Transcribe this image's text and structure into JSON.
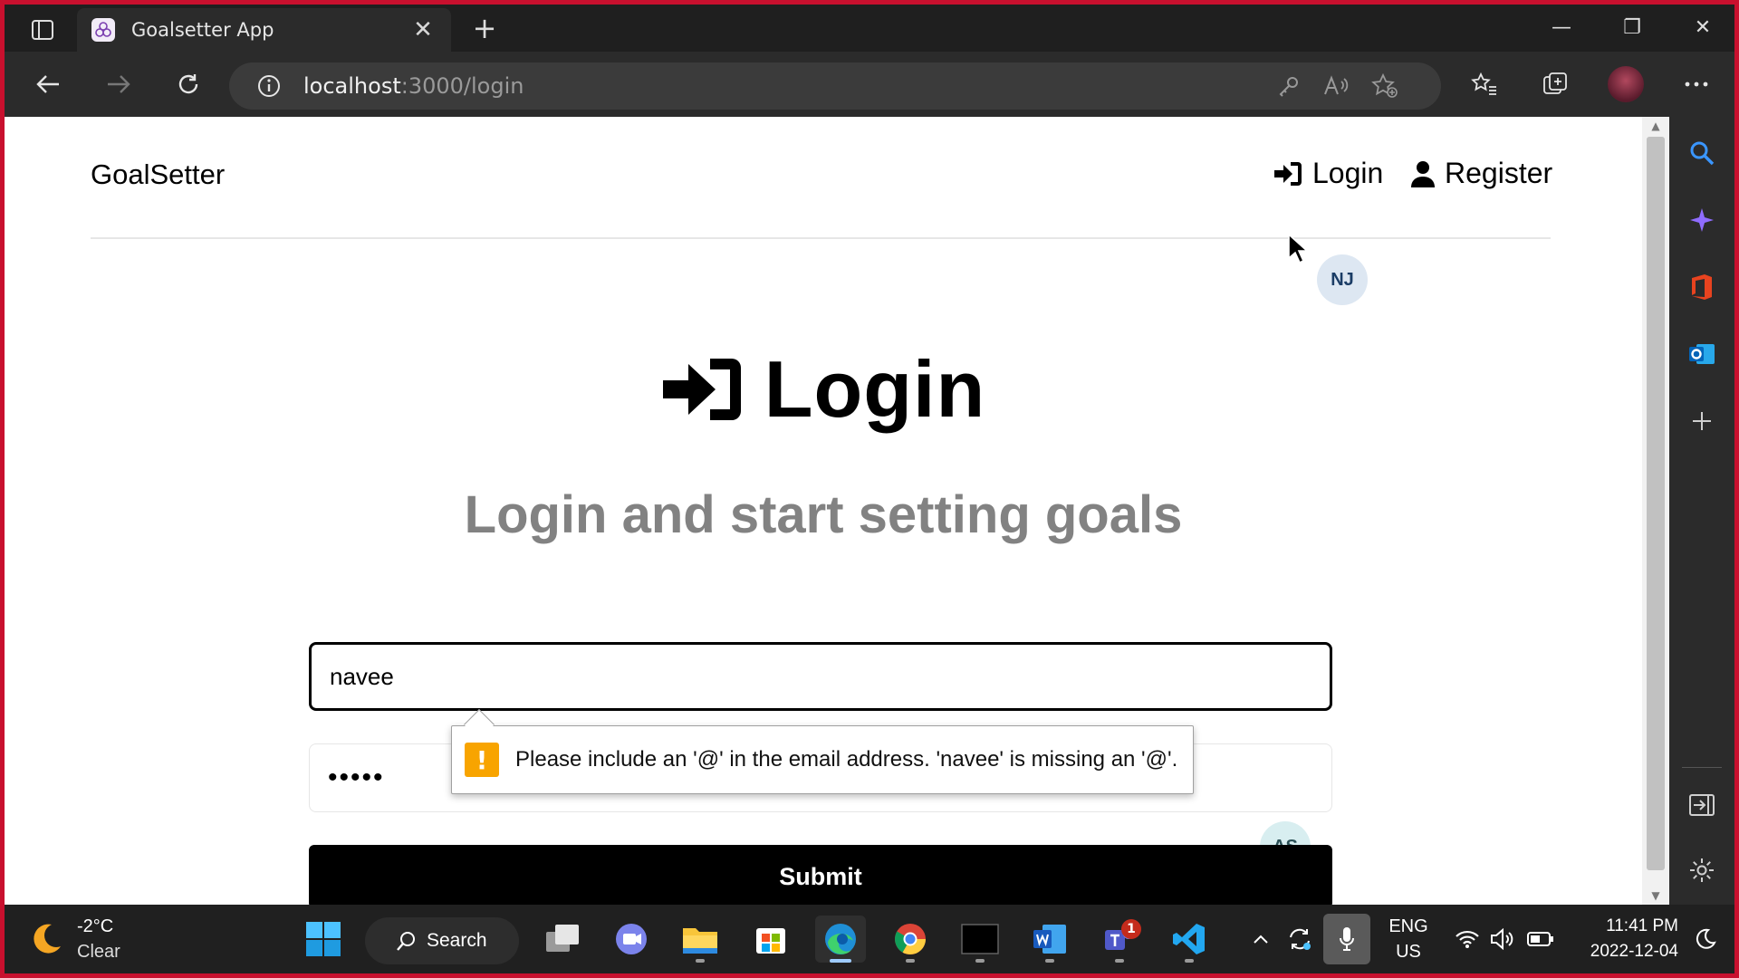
{
  "browser": {
    "tab_title": "Goalsetter App",
    "tab_close": "✕",
    "new_tab": "+",
    "url_host": "localhost",
    "url_path": ":3000/login"
  },
  "site": {
    "logo": "GoalSetter",
    "nav": {
      "login": "Login",
      "register": "Register"
    },
    "heading": "Login",
    "subheading": "Login and start setting goals",
    "email_value": "navee",
    "password_value": "•••••",
    "submit_label": "Submit",
    "validation_message": "Please include an '@' in the email address. 'navee' is missing an '@'.",
    "validation_icon": "!",
    "presence_avatars": [
      {
        "initials": "NJ",
        "bg": "#dde7f2",
        "fg": "#1b3d66"
      },
      {
        "initials": "AS",
        "bg": "#d8eef0",
        "fg": "#2a4f55"
      }
    ]
  },
  "taskbar": {
    "weather_temp": "-2°C",
    "weather_desc": "Clear",
    "search_label": "Search",
    "lang_top": "ENG",
    "lang_bottom": "US",
    "time": "11:41 PM",
    "date": "2022-12-04",
    "teams_badge": "1"
  },
  "colors": {
    "accent_red_border": "#c8102e",
    "subheading_gray": "#828282",
    "warning_orange": "#f8a400"
  }
}
